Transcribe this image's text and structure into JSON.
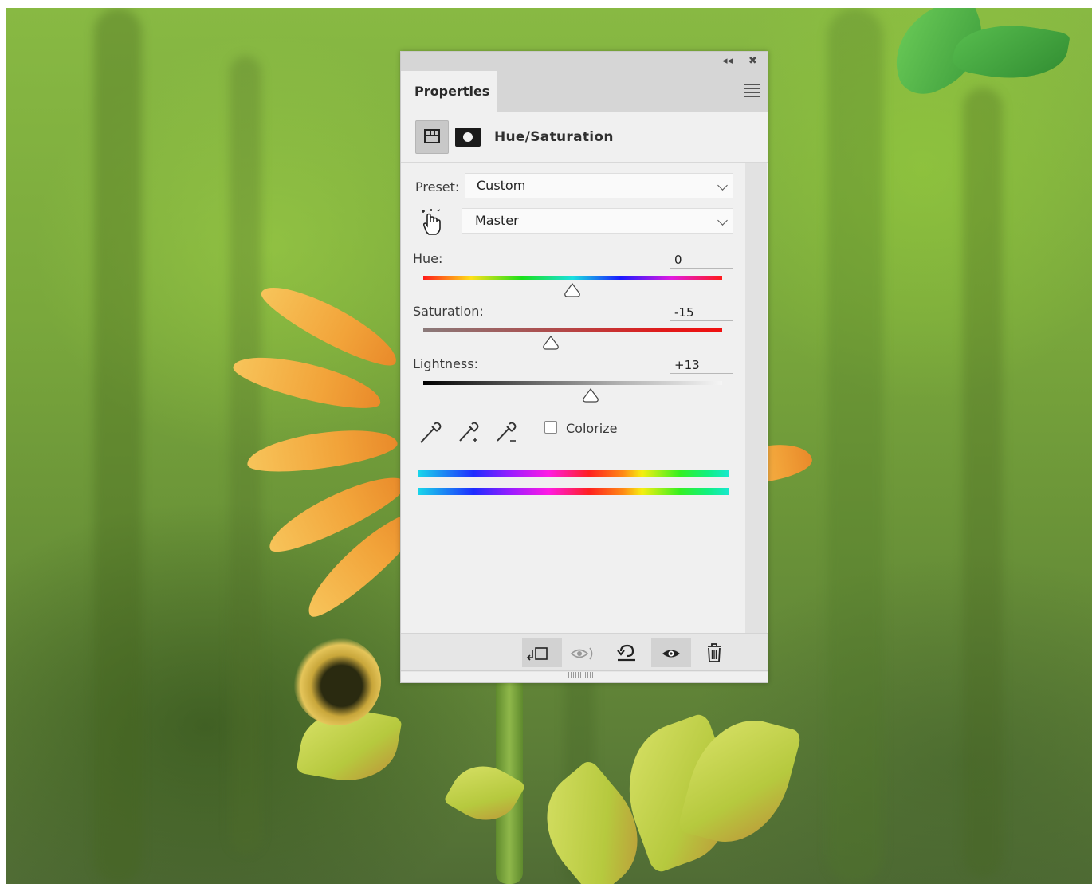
{
  "panel": {
    "tab_label": "Properties",
    "adjustment_title": "Hue/Saturation",
    "preset_label": "Preset:",
    "preset_value": "Custom",
    "channel_value": "Master",
    "hue": {
      "label": "Hue:",
      "value": "0"
    },
    "saturation": {
      "label": "Saturation:",
      "value": "-15"
    },
    "lightness": {
      "label": "Lightness:",
      "value": "+13"
    },
    "colorize_label": "Colorize",
    "colorize_checked": false
  },
  "icons": {
    "collapse": "collapse-arrows-icon",
    "close": "close-icon",
    "panel_menu": "panel-menu-icon",
    "adjustment_layer": "adjustment-layer-icon",
    "mask": "mask-icon",
    "targeted_adjustment": "hand-tool-icon",
    "eyedropper": "eyedropper-icon",
    "eyedropper_add": "eyedropper-add-icon",
    "eyedropper_subtract": "eyedropper-subtract-icon",
    "clip_to_layer": "clip-to-layer-icon",
    "view_previous": "view-previous-icon",
    "reset": "reset-icon",
    "visibility": "visibility-icon",
    "delete": "trash-icon"
  },
  "colors": {
    "panel_bg": "#f0f0f0",
    "tab_bar": "#d6d6d6"
  }
}
